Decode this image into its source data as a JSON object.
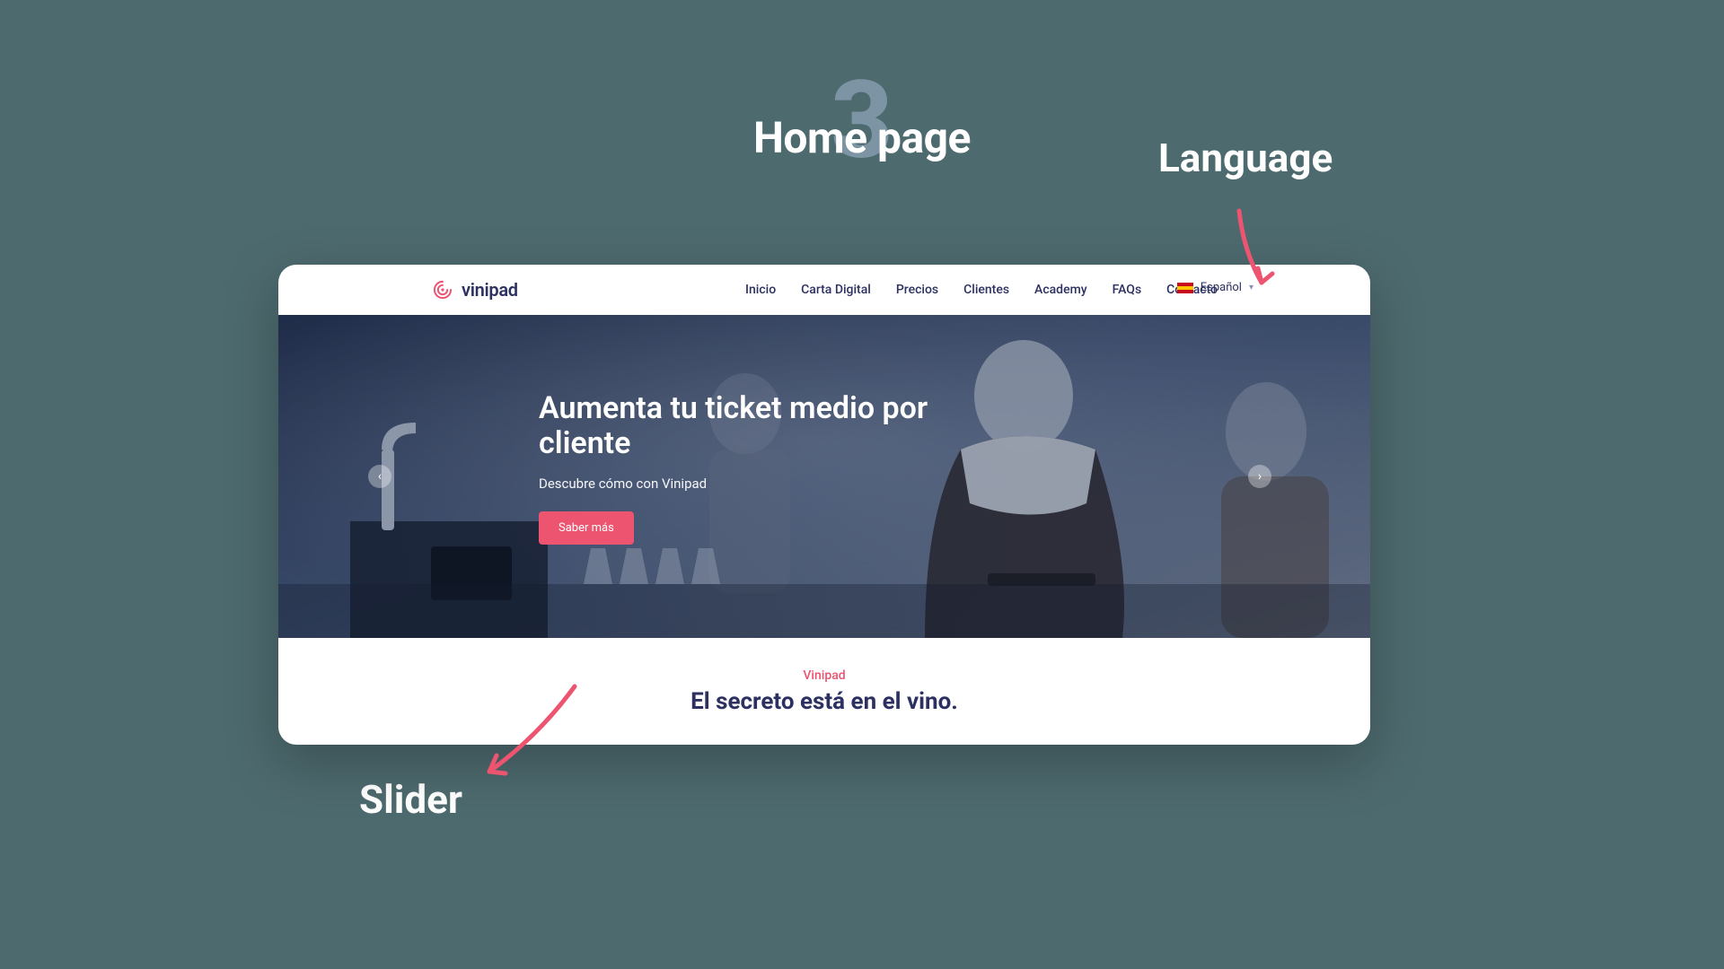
{
  "annotations": {
    "step_number": "3",
    "title": "Home page",
    "language_label": "Language",
    "slider_label": "Slider"
  },
  "brand": {
    "name": "vinipad"
  },
  "nav": {
    "items": [
      {
        "label": "Inicio"
      },
      {
        "label": "Carta Digital"
      },
      {
        "label": "Precios"
      },
      {
        "label": "Clientes"
      },
      {
        "label": "Academy"
      },
      {
        "label": "FAQs"
      },
      {
        "label": "Contacto"
      }
    ]
  },
  "language": {
    "selected": "Español"
  },
  "hero": {
    "headline": "Aumenta tu ticket medio por cliente",
    "subtitle": "Descubre cómo con Vinipad",
    "cta": "Saber más"
  },
  "section": {
    "kicker": "Vinipad",
    "title": "El secreto está en el vino."
  },
  "colors": {
    "background": "#4d6a6e",
    "accent": "#ec5470",
    "brand_text": "#2c3161"
  }
}
